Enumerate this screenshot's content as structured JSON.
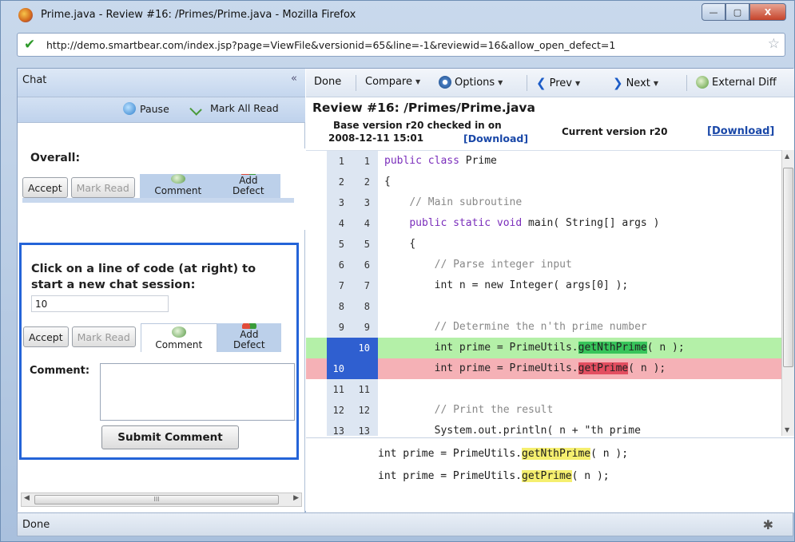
{
  "window": {
    "title": "Prime.java - Review #16: /Primes/Prime.java - Mozilla Firefox",
    "minimize": "—",
    "maximize": "▢",
    "close": "X"
  },
  "urlbar": {
    "url": "http://demo.smartbear.com/index.jsp?page=ViewFile&versionid=65&line=-1&reviewid=16&allow_open_defect=1"
  },
  "chat": {
    "title": "Chat",
    "collapse": "«",
    "pause_label": "Pause",
    "mark_all_read_label": "Mark All Read",
    "overall_label": "Overall:",
    "accept_label": "Accept",
    "mark_read_label": "Mark Read",
    "comment_label": "Comment",
    "add_defect_line1": "Add",
    "add_defect_line2": "Defect",
    "session_prompt": "Click on a line of code (at right) to start a new chat session:",
    "session_line": "10",
    "comment_field_label": "Comment:",
    "submit_label": "Submit Comment",
    "scroll_thumb": "III"
  },
  "review": {
    "toolbar": {
      "done": "Done",
      "compare": "Compare",
      "options": "Options",
      "prev": "Prev",
      "next": "Next",
      "external_diff": "External Diff"
    },
    "title": "Review #16: /Primes/Prime.java",
    "base_line1": "Base version r20 checked in on",
    "base_line2": "2008-12-11 15:01",
    "base_download": "[Download]",
    "current": "Current version r20",
    "current_download": "[Download]",
    "detail": {
      "line1_pre": "int prime = PrimeUtils.",
      "line1_hl": "getNthPrime",
      "line1_post": "( n );",
      "line2_pre": "int prime = PrimeUtils.",
      "line2_hl": "getPrime",
      "line2_post": "( n );"
    }
  },
  "code_lines": [
    {
      "left": "1",
      "right": "1",
      "pre": "",
      "kw": "public class ",
      "text": "Prime",
      "cls": ""
    },
    {
      "left": "2",
      "right": "2",
      "pre": "",
      "kw": "",
      "text": "{",
      "cls": ""
    },
    {
      "left": "3",
      "right": "3",
      "pre": "    ",
      "kw": "",
      "text": "// Main subroutine",
      "cls": "cm"
    },
    {
      "left": "4",
      "right": "4",
      "pre": "    ",
      "kw": "public static void ",
      "text": "main( String[] args )",
      "cls": ""
    },
    {
      "left": "5",
      "right": "5",
      "pre": "    ",
      "kw": "",
      "text": "{",
      "cls": ""
    },
    {
      "left": "6",
      "right": "6",
      "pre": "        ",
      "kw": "",
      "text": "// Parse integer input",
      "cls": "cm"
    },
    {
      "left": "7",
      "right": "7",
      "pre": "        ",
      "kw": "",
      "text": "int n = new Integer( args[0] );",
      "cls": ""
    },
    {
      "left": "8",
      "right": "8",
      "pre": "",
      "kw": "",
      "text": "",
      "cls": ""
    },
    {
      "left": "9",
      "right": "9",
      "pre": "        ",
      "kw": "",
      "text": "// Determine the n'th prime number",
      "cls": "cm"
    },
    {
      "left": "",
      "right": "10",
      "pre": "        ",
      "kw": "",
      "text": "int prime = PrimeUtils.",
      "hl": "getNthPrime",
      "post": "( n );",
      "cls": "added"
    },
    {
      "left": "10",
      "right": "",
      "pre": "        ",
      "kw": "",
      "text": "int prime = PrimeUtils.",
      "hl": "getPrime",
      "post": "( n );",
      "cls": "removed"
    },
    {
      "left": "11",
      "right": "11",
      "pre": "",
      "kw": "",
      "text": "",
      "cls": ""
    },
    {
      "left": "12",
      "right": "12",
      "pre": "        ",
      "kw": "",
      "text": "// Print the result",
      "cls": "cm"
    },
    {
      "left": "13",
      "right": "13",
      "pre": "        ",
      "kw": "",
      "text": "System.out.println( n + \"th prime",
      "cls": ""
    }
  ],
  "status": {
    "text": "Done"
  }
}
